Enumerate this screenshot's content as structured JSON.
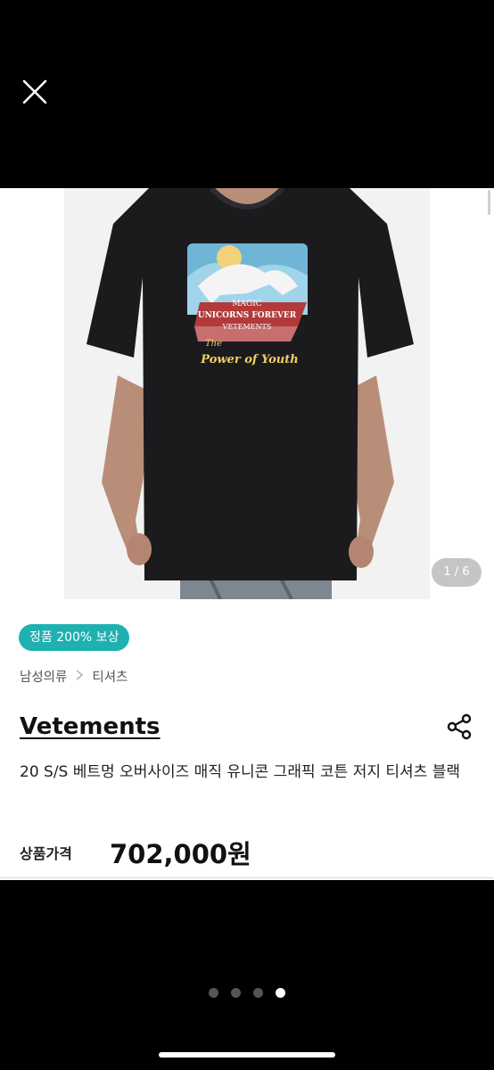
{
  "header": {
    "close_icon": "close-icon"
  },
  "image": {
    "counter": "1 / 6",
    "graphic_text": {
      "top": "MAGIC",
      "middle": "UNICORNS FOREVER",
      "brand": "VETEMENTS",
      "line1": "The",
      "line2": "Power of Youth"
    }
  },
  "badge": {
    "label": "정품 200% 보상",
    "color": "#1fb0b0"
  },
  "breadcrumb": {
    "items": [
      "남성의류",
      "티셔츠"
    ]
  },
  "product": {
    "brand": "Vetements",
    "title": "20 S/S 베트멍 오버사이즈 매직 유니콘 그래픽 코튼 저지 티셔츠 블랙",
    "price_label": "상품가격",
    "price": "702,000원"
  },
  "pager": {
    "count": 4,
    "active_index": 3
  },
  "icons": {
    "share": "share-icon",
    "chevron": "chevron-right-icon"
  }
}
